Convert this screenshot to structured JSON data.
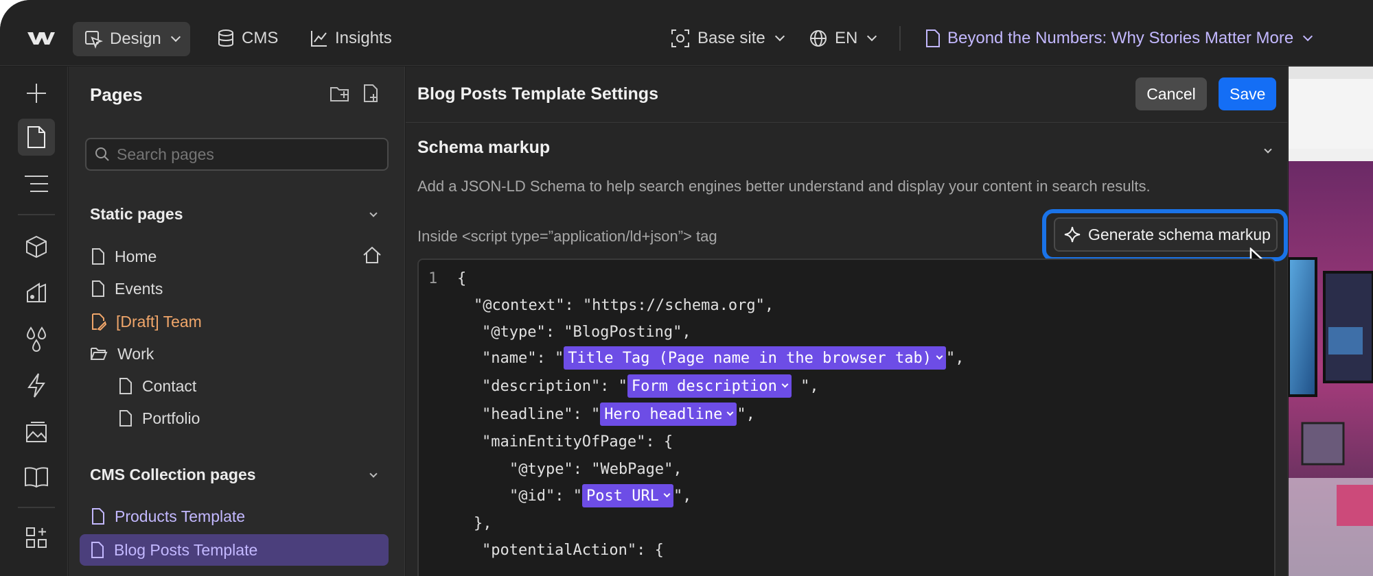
{
  "topbar": {
    "mode_label": "Design",
    "cms_label": "CMS",
    "insights_label": "Insights",
    "site_label": "Base site",
    "locale_label": "EN",
    "page_title": "Beyond the Numbers: Why Stories Matter More"
  },
  "pages_panel": {
    "title": "Pages",
    "search_placeholder": "Search pages",
    "static_heading": "Static pages",
    "static_pages": [
      {
        "label": "Home"
      },
      {
        "label": "Events"
      },
      {
        "label": "[Draft] Team"
      },
      {
        "label": "Work"
      },
      {
        "label": "Contact"
      },
      {
        "label": "Portfolio"
      }
    ],
    "cms_heading": "CMS Collection pages",
    "cms_pages": [
      {
        "label": "Products Template"
      },
      {
        "label": "Blog Posts Template"
      }
    ]
  },
  "settings": {
    "title": "Blog Posts Template Settings",
    "cancel_label": "Cancel",
    "save_label": "Save",
    "section_title": "Schema markup",
    "description": "Add a JSON-LD Schema to help search engines better understand and display your content in search results.",
    "script_label": "Inside <script type=”application/ld+json”> tag",
    "generate_label": "Generate schema markup"
  },
  "code": {
    "line_number": "1",
    "open_brace": "{",
    "context_line": "\"@context\": \"https://schema.org\",",
    "type_line": "\"@type\": \"BlogPosting\",",
    "name_key": "\"name\": \"",
    "name_token": "Title Tag (Page name in the browser tab)",
    "name_end": "\",",
    "description_key": "\"description\": \"",
    "description_token": "Form description",
    "description_end": " \",",
    "headline_key": "\"headline\": \"",
    "headline_token": "Hero headline",
    "headline_end": "\",",
    "main_entity_line": "\"mainEntityOfPage\": {",
    "webpage_type_line": "\"@type\": \"WebPage\",",
    "id_key": "\"@id\": \"",
    "id_token": "Post URL",
    "id_end": "\",",
    "close_inner": "},",
    "potential_action_line": "\"potentialAction\": {"
  }
}
